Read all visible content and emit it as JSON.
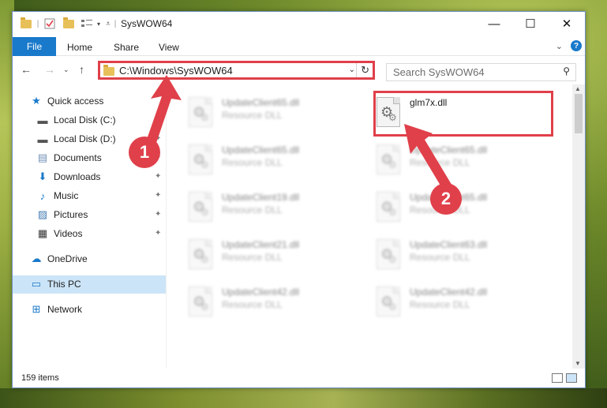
{
  "window": {
    "title": "SysWOW64",
    "buttons": {
      "minimize": "—",
      "maximize": "☐",
      "close": "✕"
    }
  },
  "ribbon": {
    "tabs": [
      "File",
      "Home",
      "Share",
      "View"
    ],
    "collapse": "⌄",
    "help": "?"
  },
  "nav": {
    "back": "←",
    "forward": "→",
    "recent": "⌄",
    "up": "↑",
    "address": "C:\\Windows\\SysWOW64",
    "address_dropdown": "⌄",
    "refresh": "↻",
    "search_placeholder": "Search SysWOW64",
    "search_icon": "⚲"
  },
  "sidebar": {
    "items": [
      {
        "label": "Quick access",
        "icon": "star-icon",
        "glyph": "★",
        "color": "#1979ca",
        "pinned": false
      },
      {
        "label": "Local Disk (C:)",
        "icon": "drive-icon",
        "glyph": "▬",
        "color": "#555555",
        "pinned": true
      },
      {
        "label": "Local Disk (D:)",
        "icon": "drive-icon",
        "glyph": "▬",
        "color": "#555555",
        "pinned": true
      },
      {
        "label": "Documents",
        "icon": "documents-icon",
        "glyph": "▤",
        "color": "#6f8fb7",
        "pinned": true
      },
      {
        "label": "Downloads",
        "icon": "download-icon",
        "glyph": "⬇",
        "color": "#1979ca",
        "pinned": true
      },
      {
        "label": "Music",
        "icon": "music-icon",
        "glyph": "♪",
        "color": "#1979ca",
        "pinned": true
      },
      {
        "label": "Pictures",
        "icon": "pictures-icon",
        "glyph": "▨",
        "color": "#4a7fb5",
        "pinned": true
      },
      {
        "label": "Videos",
        "icon": "videos-icon",
        "glyph": "▦",
        "color": "#333333",
        "pinned": true
      },
      {
        "label": "OneDrive",
        "icon": "cloud-icon",
        "glyph": "☁",
        "color": "#1979ca",
        "pinned": false
      },
      {
        "label": "This PC",
        "icon": "computer-icon",
        "glyph": "▭",
        "color": "#1979ca",
        "pinned": false,
        "selected": true
      },
      {
        "label": "Network",
        "icon": "network-icon",
        "glyph": "⊞",
        "color": "#1979ca",
        "pinned": false
      }
    ],
    "pin_glyph": "📌"
  },
  "files": {
    "left": [
      {
        "name": "UpdateClient65.dll",
        "desc": "Resource DLL"
      },
      {
        "name": "UpdateClient65.dll",
        "desc": "Resource DLL"
      },
      {
        "name": "UpdateClient19.dll",
        "desc": "Resource DLL"
      },
      {
        "name": "UpdateClient21.dll",
        "desc": "Resource DLL"
      },
      {
        "name": "UpdateClient42.dll",
        "desc": "Resource DLL"
      }
    ],
    "right": [
      {
        "name": "glm7x.dll",
        "desc": "",
        "highlighted": true
      },
      {
        "name": "UpdateClient65.dll",
        "desc": "Resource DLL"
      },
      {
        "name": "UpdateClient65.dll",
        "desc": "Resource DLL"
      },
      {
        "name": "UpdateClient63.dll",
        "desc": "Resource DLL"
      },
      {
        "name": "UpdateClient42.dll",
        "desc": "Resource DLL"
      }
    ]
  },
  "status": {
    "item_count": "159 items"
  },
  "annotations": {
    "step1": "1",
    "step2": "2",
    "color": "#e0404a"
  }
}
